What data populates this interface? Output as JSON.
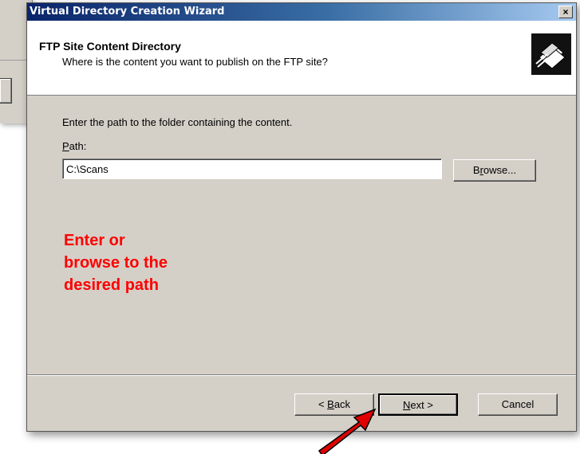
{
  "window": {
    "title": "Virtual Directory Creation Wizard",
    "close_glyph": "×"
  },
  "header": {
    "title": "FTP Site Content Directory",
    "subtitle": "Where is the content you want to publish on the FTP site?",
    "icon": "wizard-folder-icon"
  },
  "body": {
    "instruction": "Enter the path to the folder containing the content.",
    "path_label_accel": "P",
    "path_label_rest": "ath:",
    "path_value": "C:\\Scans",
    "browse_prefix": "B",
    "browse_accel": "r",
    "browse_rest": "owse..."
  },
  "annotation": {
    "line1": "Enter or",
    "line2": "browse to the",
    "line3": "desired path",
    "color": "#ff0000"
  },
  "footer": {
    "back_prefix": "< ",
    "back_accel": "B",
    "back_rest": "ack",
    "next_accel": "N",
    "next_rest": "ext >",
    "cancel_label": "Cancel"
  },
  "colors": {
    "dialog_bg": "#d4d0c8",
    "titlebar_start": "#0a246a",
    "arrow": "#e00000"
  }
}
